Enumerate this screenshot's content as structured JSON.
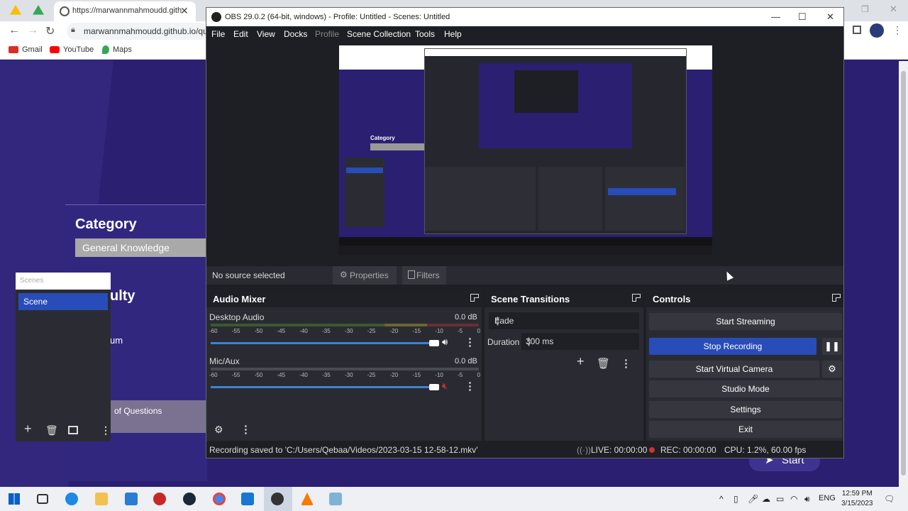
{
  "browser": {
    "tab_title": "https://marwannmahmoudd.gith",
    "url": "marwannmahmoudd.github.io/qu",
    "bookmarks": [
      {
        "label": "Gmail",
        "icon": "gmail-icon",
        "color": "#d93025"
      },
      {
        "label": "YouTube",
        "icon": "youtube-icon",
        "color": "#ff0000"
      },
      {
        "label": "Maps",
        "icon": "maps-icon",
        "color": "#34a853"
      }
    ]
  },
  "page": {
    "category_label": "Category",
    "category_value": "General Knowledge",
    "difficulty_partial": "ulty",
    "medium_partial": "um",
    "questions_partial": "of Questions",
    "start_label": "Start"
  },
  "scenes_dock": {
    "header": "Scenes",
    "items": [
      "Scene"
    ]
  },
  "obs": {
    "title": "OBS 29.0.2 (64-bit, windows) - Profile: Untitled - Scenes: Untitled",
    "menu": [
      "File",
      "Edit",
      "View",
      "Docks",
      "Profile",
      "Scene Collection",
      "Tools",
      "Help"
    ],
    "source_bar": {
      "status": "No source selected",
      "properties": "Properties",
      "filters": "Filters"
    },
    "audio_mixer": {
      "title": "Audio Mixer",
      "ticks": [
        "-60",
        "-55",
        "-50",
        "-45",
        "-40",
        "-35",
        "-30",
        "-25",
        "-20",
        "-15",
        "-10",
        "-5",
        "0"
      ],
      "channels": [
        {
          "name": "Desktop Audio",
          "db": "0.0 dB",
          "muted": false
        },
        {
          "name": "Mic/Aux",
          "db": "0.0 dB",
          "muted": true
        }
      ]
    },
    "transitions": {
      "title": "Scene Transitions",
      "selected": "Fade",
      "duration_label": "Duration",
      "duration_value": "300 ms"
    },
    "controls": {
      "title": "Controls",
      "start_streaming": "Start Streaming",
      "stop_recording": "Stop Recording",
      "start_virtual_camera": "Start Virtual Camera",
      "studio_mode": "Studio Mode",
      "settings": "Settings",
      "exit": "Exit"
    },
    "status": {
      "message": "Recording saved to 'C:/Users/Qebaa/Videos/2023-03-15 12-58-12.mkv'",
      "live": "LIVE: 00:00:00",
      "rec": "REC: 00:00:00",
      "cpu": "CPU: 1.2%, 60.00 fps"
    }
  },
  "taskbar": {
    "lang": "ENG",
    "time": "12:59 PM",
    "date": "3/15/2023"
  },
  "colors": {
    "accent_blue": "#284cb8",
    "page_purple": "#2b1f72",
    "obs_dark": "#1e1f24"
  }
}
